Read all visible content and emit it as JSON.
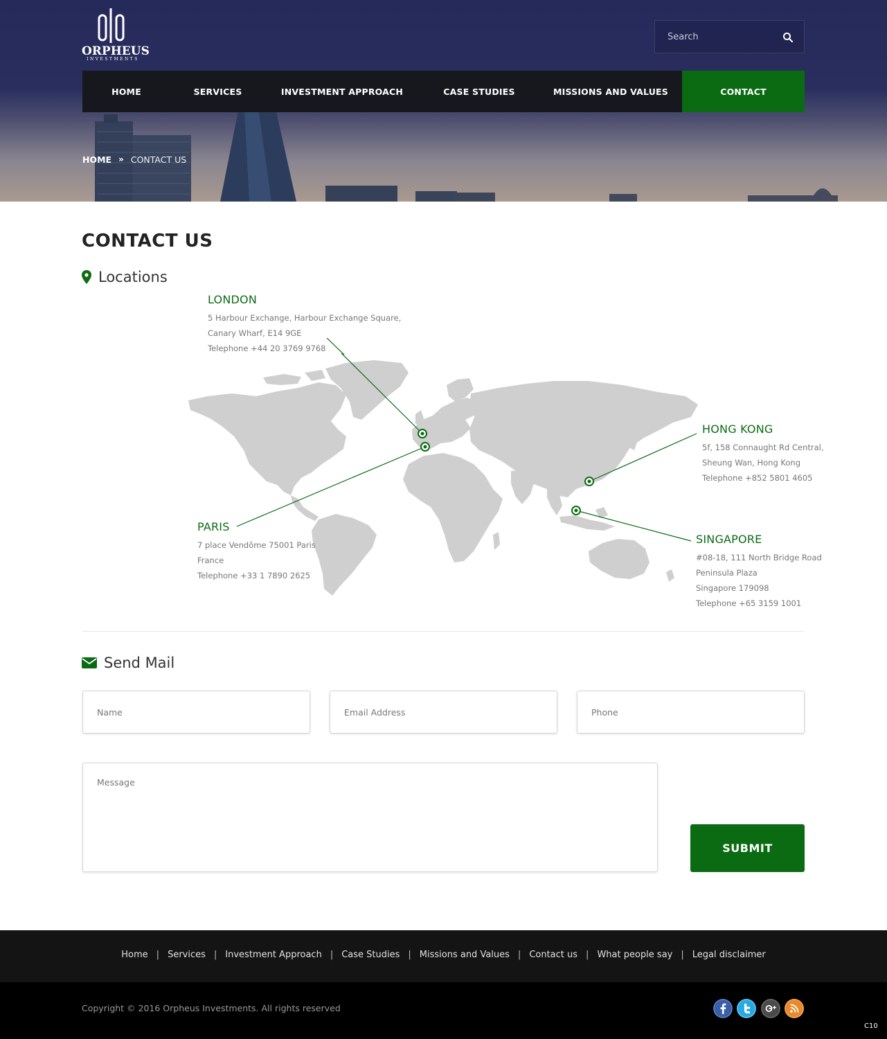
{
  "brand": {
    "name": "ORPHEUS",
    "tagline": "INVESTMENTS"
  },
  "search": {
    "placeholder": "Search"
  },
  "nav": {
    "items": [
      {
        "label": "HOME"
      },
      {
        "label": "SERVICES"
      },
      {
        "label": "INVESTMENT APPROACH"
      },
      {
        "label": "CASE STUDIES"
      },
      {
        "label": "MISSIONS AND VALUES"
      },
      {
        "label": "CONTACT"
      }
    ],
    "active_index": 5
  },
  "breadcrumb": {
    "home": "HOME",
    "separator": "»",
    "current": "CONTACT US"
  },
  "page": {
    "title": "CONTACT US"
  },
  "locations": {
    "heading": "Locations",
    "london": {
      "name": "LONDON",
      "lines": [
        "5 Harbour Exchange, Harbour Exchange Square,",
        "Canary Wharf, E14 9GE",
        "Telephone +44 20 3769 9768"
      ]
    },
    "paris": {
      "name": "PARIS",
      "lines": [
        "7 place Vendôme 75001 Paris",
        "France",
        "Telephone +33 1 7890 2625"
      ]
    },
    "hongkong": {
      "name": "HONG KONG",
      "lines": [
        "5f, 158 Connaught Rd Central,",
        "Sheung Wan, Hong Kong",
        "Telephone +852 5801 4605"
      ]
    },
    "singapore": {
      "name": "SINGAPORE",
      "lines": [
        "#08-18, 111 North Bridge Road",
        "Peninsula Plaza",
        "Singapore 179098",
        "Telephone +65 3159 1001"
      ]
    }
  },
  "mail": {
    "heading": "Send Mail",
    "name_placeholder": "Name",
    "email_placeholder": "Email Address",
    "phone_placeholder": "Phone",
    "message_placeholder": "Message",
    "submit_label": "SUBMIT"
  },
  "footer": {
    "links": [
      "Home",
      "Services",
      "Investment Approach",
      "Case Studies",
      "Missions and Values",
      "Contact us",
      "What people say",
      "Legal disclaimer"
    ],
    "separator": "|",
    "copyright": "Copyright © 2016 Orpheus Investments. All rights reserved",
    "social": [
      {
        "icon": "facebook-icon",
        "glyph": "f",
        "color": "#3b5ea8"
      },
      {
        "icon": "twitter-icon",
        "glyph": "t",
        "color": "#29a9e1"
      },
      {
        "icon": "google-plus-icon",
        "glyph": "g+",
        "color": "#4a4a4a"
      },
      {
        "icon": "rss-icon",
        "glyph": "rss",
        "color": "#e8892b"
      }
    ],
    "page_code": "C10"
  },
  "colors": {
    "accent": "#0b6b12",
    "nav_bg": "#17181d",
    "header_sky": "#262a5a",
    "footer_bg": "#141414"
  }
}
